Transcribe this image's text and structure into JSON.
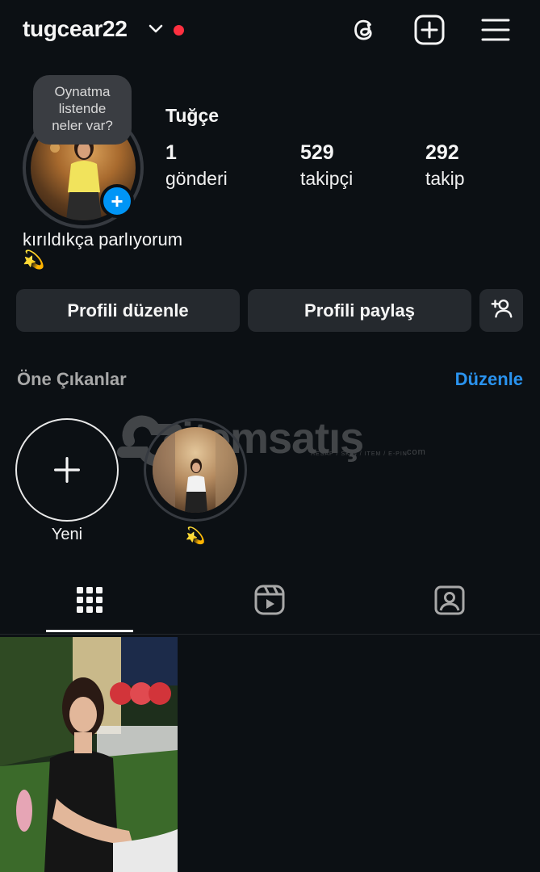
{
  "header": {
    "username": "tugcear22",
    "icons": [
      "chevron-down-icon",
      "threads-icon",
      "create-post-icon",
      "menu-icon"
    ],
    "notification_color": "#ff3040"
  },
  "profile": {
    "note": [
      "Oynatma",
      "listende",
      "neler var?"
    ],
    "display_name": "Tuğçe",
    "stats": [
      {
        "value": "1",
        "label": "gönderi"
      },
      {
        "value": "529",
        "label": "takipçi"
      },
      {
        "value": "292",
        "label": "takip"
      }
    ],
    "bio": "kırıldıkça parlıyorum",
    "bio_emoji": "💫"
  },
  "actions": {
    "edit_profile": "Profili düzenle",
    "share_profile": "Profili paylaş",
    "discover_icon": "add-person-icon"
  },
  "highlights": {
    "title": "Öne Çıkanlar",
    "edit": "Düzenle",
    "items": [
      {
        "label": "Yeni"
      },
      {
        "label": "💫"
      }
    ]
  },
  "watermark": {
    "text": "itemsatış",
    "small": "HESAP / SKIN / ITEM / E-PIN",
    "com": ".com"
  },
  "tabs": [
    {
      "name": "posts",
      "icon": "grid-icon",
      "active": true
    },
    {
      "name": "reels",
      "icon": "reels-icon",
      "active": false
    },
    {
      "name": "tagged",
      "icon": "tagged-icon",
      "active": false
    }
  ],
  "colors": {
    "background": "#0c1014",
    "button": "#25292e",
    "link": "#2a93ef",
    "accent_blue": "#0095f6"
  }
}
